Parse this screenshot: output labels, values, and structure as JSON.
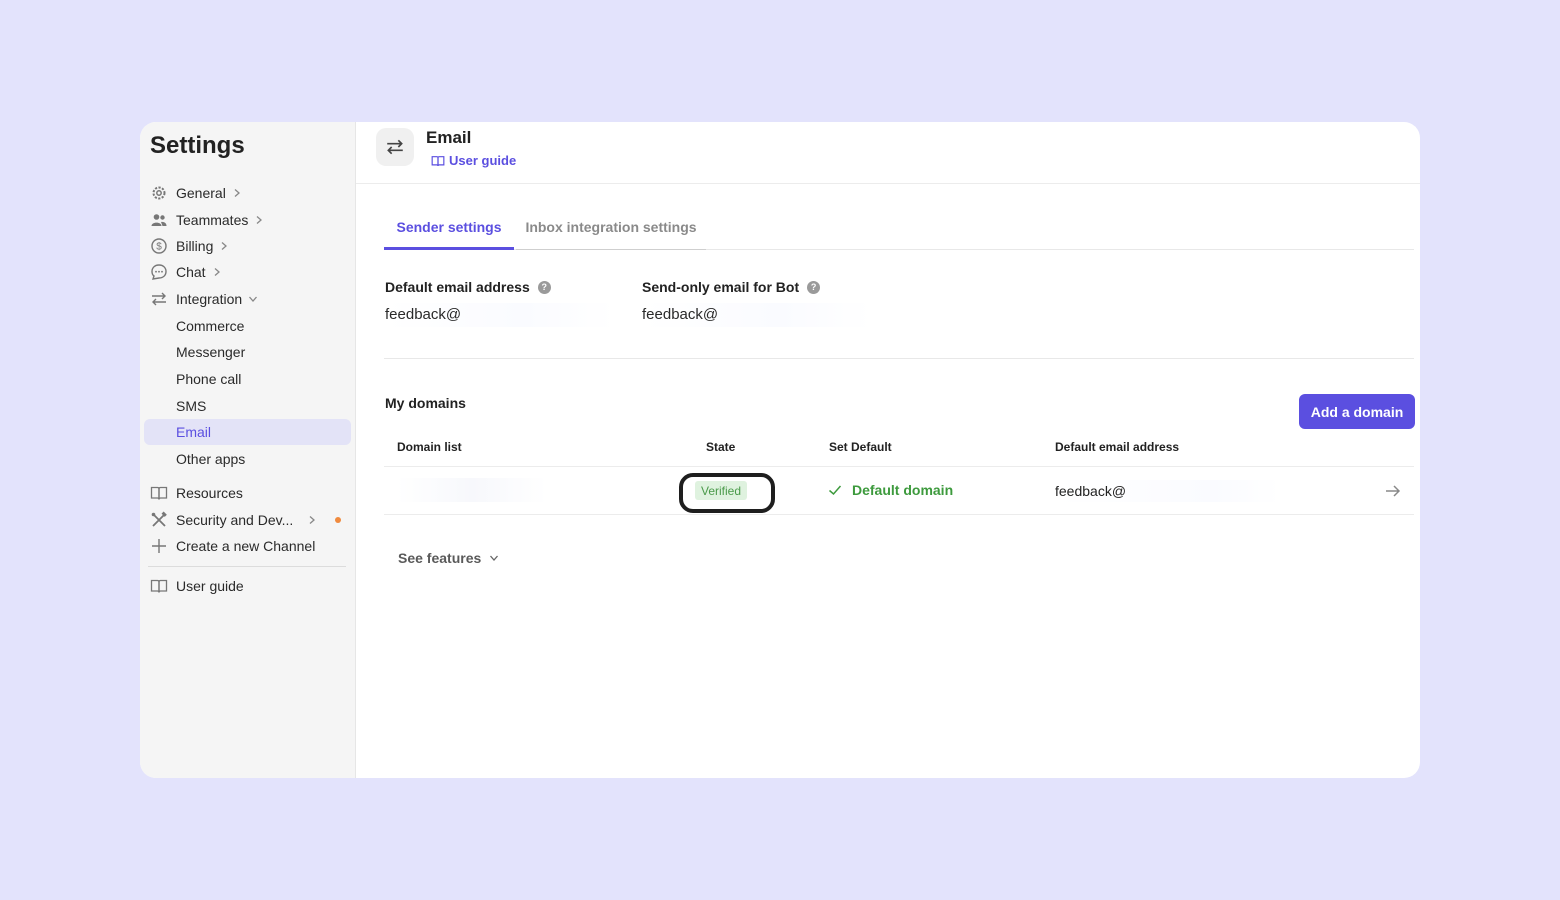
{
  "sidebar": {
    "title": "Settings",
    "items": [
      {
        "label": "General",
        "icon": "gear-icon"
      },
      {
        "label": "Teammates",
        "icon": "people-icon"
      },
      {
        "label": "Billing",
        "icon": "dollar-icon"
      },
      {
        "label": "Chat",
        "icon": "chat-bubble-icon"
      },
      {
        "label": "Integration",
        "icon": "swap-arrows-icon"
      },
      {
        "label": "Commerce"
      },
      {
        "label": "Messenger"
      },
      {
        "label": "Phone call"
      },
      {
        "label": "SMS"
      },
      {
        "label": "Email"
      },
      {
        "label": "Other apps"
      },
      {
        "label": "Resources",
        "icon": "book-icon"
      },
      {
        "label": "Security and Dev...",
        "icon": "tools-icon"
      },
      {
        "label": "Create a new Channel",
        "icon": "plus-icon"
      },
      {
        "label": "User guide",
        "icon": "book-icon"
      }
    ],
    "active_item": "Email"
  },
  "header": {
    "title": "Email",
    "link_label": "User guide",
    "icon": "swap-arrows-icon"
  },
  "tabs": [
    {
      "label": "Sender settings",
      "active": true
    },
    {
      "label": "Inbox integration settings",
      "active": false
    }
  ],
  "sender": {
    "default_label": "Default email address",
    "default_value": "feedback@",
    "sendonly_label": "Send-only email for Bot",
    "sendonly_value": "feedback@"
  },
  "domains": {
    "title": "My domains",
    "add_button": "Add a domain",
    "columns": [
      "Domain list",
      "State",
      "Set Default",
      "Default email address"
    ],
    "rows": [
      {
        "domain": "",
        "state": "Verified",
        "set_default": "Default domain",
        "email": "feedback@"
      }
    ]
  },
  "see_features": "See features",
  "colors": {
    "accent": "#5b4fe0",
    "success": "#3d9a3d",
    "background": "#e3e3fc",
    "warning_dot": "#f08a3e"
  }
}
